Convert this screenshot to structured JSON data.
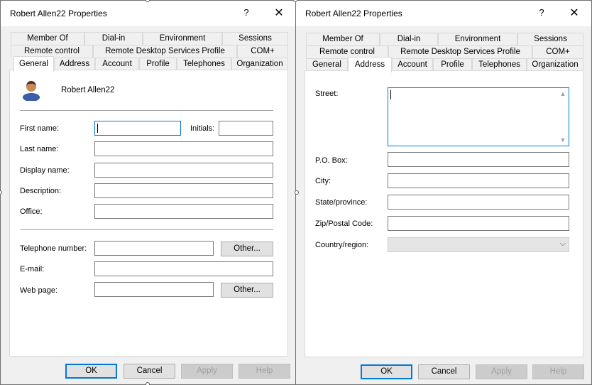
{
  "left": {
    "title": "Robert Allen22 Properties",
    "help": "?",
    "close": "✕",
    "tabs_row1": [
      "Member Of",
      "Dial-in",
      "Environment",
      "Sessions"
    ],
    "tabs_row2": [
      "Remote control",
      "Remote Desktop Services Profile",
      "COM+"
    ],
    "tabs_row3": [
      "General",
      "Address",
      "Account",
      "Profile",
      "Telephones",
      "Organization"
    ],
    "user_name": "Robert Allen22",
    "fields": {
      "first_name": "First name:",
      "initials": "Initials:",
      "last_name": "Last name:",
      "display_name": "Display name:",
      "description": "Description:",
      "office": "Office:",
      "telephone": "Telephone number:",
      "email": "E-mail:",
      "web_page": "Web page:"
    },
    "other_btn": "Other...",
    "buttons": {
      "ok": "OK",
      "cancel": "Cancel",
      "apply": "Apply",
      "help": "Help"
    }
  },
  "right": {
    "title": "Robert Allen22 Properties",
    "help": "?",
    "close": "✕",
    "tabs_row1": [
      "Member Of",
      "Dial-in",
      "Environment",
      "Sessions"
    ],
    "tabs_row2": [
      "Remote control",
      "Remote Desktop Services Profile",
      "COM+"
    ],
    "tabs_row3": [
      "General",
      "Address",
      "Account",
      "Profile",
      "Telephones",
      "Organization"
    ],
    "fields": {
      "street": "Street:",
      "po_box": "P.O. Box:",
      "city": "City:",
      "state": "State/province:",
      "zip": "Zip/Postal Code:",
      "country": "Country/region:"
    },
    "buttons": {
      "ok": "OK",
      "cancel": "Cancel",
      "apply": "Apply",
      "help": "Help"
    }
  }
}
